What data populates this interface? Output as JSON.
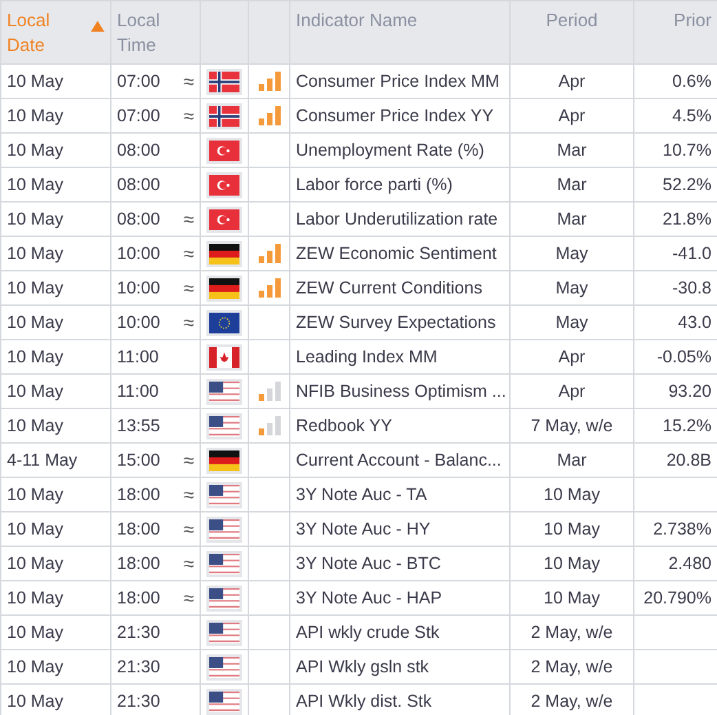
{
  "columns": [
    {
      "label": "Local Date",
      "sorted": true
    },
    {
      "label": "Local Time",
      "sorted": false
    },
    {
      "sorted": false
    },
    {
      "sorted": false
    },
    {
      "label": "Indicator Name",
      "sorted": false
    },
    {
      "label": "Period",
      "sorted": false
    },
    {
      "label": "Prior",
      "sorted": false
    }
  ],
  "rows": [
    {
      "date": "10 May",
      "time": "07:00",
      "mark": "≈",
      "kind": "no",
      "level": 1,
      "name": "Consumer Price Index MM",
      "period": "Apr",
      "prior": "0.6%"
    },
    {
      "date": "10 May",
      "time": "07:00",
      "mark": "≈",
      "kind": "no",
      "level": 1,
      "name": "Consumer Price Index YY",
      "period": "Apr",
      "prior": "4.5%"
    },
    {
      "date": "10 May",
      "time": "08:00",
      "kind": "tr",
      "name": "Unemployment Rate (%)",
      "period": "Mar",
      "prior": "10.7%"
    },
    {
      "date": "10 May",
      "time": "08:00",
      "kind": "tr",
      "name": "Labor force parti (%)",
      "period": "Mar",
      "prior": "52.2%"
    },
    {
      "date": "10 May",
      "time": "08:00",
      "mark": "≈",
      "kind": "tr",
      "name": "Labor Underutilization rate",
      "period": "Mar",
      "prior": "21.8%"
    },
    {
      "date": "10 May",
      "time": "10:00",
      "mark": "≈",
      "kind": "de",
      "level": 1,
      "name": "ZEW Economic Sentiment",
      "period": "May",
      "prior": "-41.0"
    },
    {
      "date": "10 May",
      "time": "10:00",
      "mark": "≈",
      "kind": "de",
      "level": 1,
      "name": "ZEW Current Conditions",
      "period": "May",
      "prior": "-30.8"
    },
    {
      "date": "10 May",
      "time": "10:00",
      "mark": "≈",
      "kind": "eu",
      "name": "ZEW Survey Expectations",
      "period": "May",
      "prior": "43.0"
    },
    {
      "date": "10 May",
      "time": "11:00",
      "kind": "ca",
      "name": "Leading Index MM",
      "period": "Apr",
      "prior": "-0.05%"
    },
    {
      "date": "10 May",
      "time": "11:00",
      "kind": "us",
      "level": 0.33,
      "name": "NFIB Business Optimism ...",
      "period": "Apr",
      "prior": "93.20"
    },
    {
      "date": "10 May",
      "time": "13:55",
      "kind": "us",
      "level": 0.33,
      "name": "Redbook YY",
      "period": "7 May, w/e",
      "prior": "15.2%"
    },
    {
      "date": "4-11 May",
      "time": "15:00",
      "mark": "≈",
      "kind": "de",
      "name": "Current Account - Balanc...",
      "period": "Mar",
      "prior": "20.8B"
    },
    {
      "date": "10 May",
      "time": "18:00",
      "mark": "≈",
      "kind": "us",
      "name": "3Y Note Auc - TA",
      "period": "10 May"
    },
    {
      "date": "10 May",
      "time": "18:00",
      "mark": "≈",
      "kind": "us",
      "name": "3Y Note Auc - HY",
      "period": "10 May",
      "prior": "2.738%"
    },
    {
      "date": "10 May",
      "time": "18:00",
      "mark": "≈",
      "kind": "us",
      "name": "3Y Note Auc - BTC",
      "period": "10 May",
      "prior": "2.480"
    },
    {
      "date": "10 May",
      "time": "18:00",
      "mark": "≈",
      "kind": "us",
      "name": "3Y Note Auc - HAP",
      "period": "10 May",
      "prior": "20.790%"
    },
    {
      "date": "10 May",
      "time": "21:30",
      "kind": "us",
      "name": "API wkly crude Stk",
      "period": "2 May, w/e"
    },
    {
      "date": "10 May",
      "time": "21:30",
      "kind": "us",
      "name": "API Wkly gsln stk",
      "period": "2 May, w/e"
    },
    {
      "date": "10 May",
      "time": "21:30",
      "kind": "us",
      "name": "API Wkly dist. Stk",
      "period": "2 May, w/e"
    }
  ]
}
